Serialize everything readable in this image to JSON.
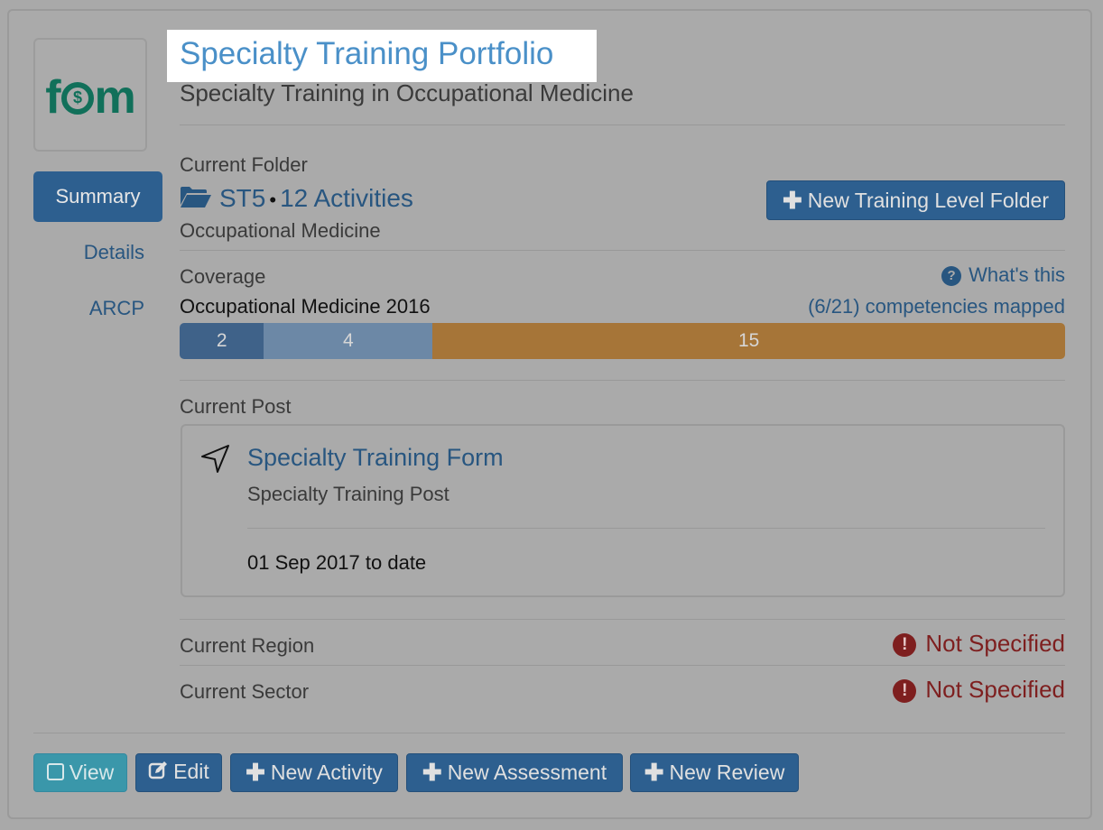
{
  "header": {
    "title": "Specialty Training Portfolio",
    "subtitle": "Specialty Training in Occupational Medicine"
  },
  "logo": {
    "text_left": "f",
    "text_right": "m",
    "symbol": "$"
  },
  "sidebar": {
    "items": [
      {
        "label": "Summary",
        "active": true
      },
      {
        "label": "Details",
        "active": false
      },
      {
        "label": "ARCP",
        "active": false
      }
    ]
  },
  "folder": {
    "label": "Current Folder",
    "name": "ST5",
    "separator": "•",
    "activities": "12 Activities",
    "specialty": "Occupational Medicine",
    "new_button": "New Training Level Folder"
  },
  "coverage": {
    "label": "Coverage",
    "help": "What's this",
    "curriculum": "Occupational Medicine 2016",
    "mapped": "(6/21) competencies mapped",
    "segments": [
      {
        "value": 2,
        "label": "2",
        "color": "#3f6289"
      },
      {
        "value": 4,
        "label": "4",
        "color": "#6c88a6"
      },
      {
        "value": 15,
        "label": "15",
        "color": "#a67538"
      }
    ]
  },
  "post": {
    "label": "Current Post",
    "title": "Specialty Training Form",
    "subtitle": "Specialty Training Post",
    "dates": "01 Sep 2017 to date"
  },
  "region": {
    "label": "Current Region",
    "value": "Not Specified"
  },
  "sector": {
    "label": "Current Sector",
    "value": "Not Specified"
  },
  "actions": {
    "view": "View",
    "edit": "Edit",
    "new_activity": "New Activity",
    "new_assessment": "New Assessment",
    "new_review": "New Review"
  }
}
